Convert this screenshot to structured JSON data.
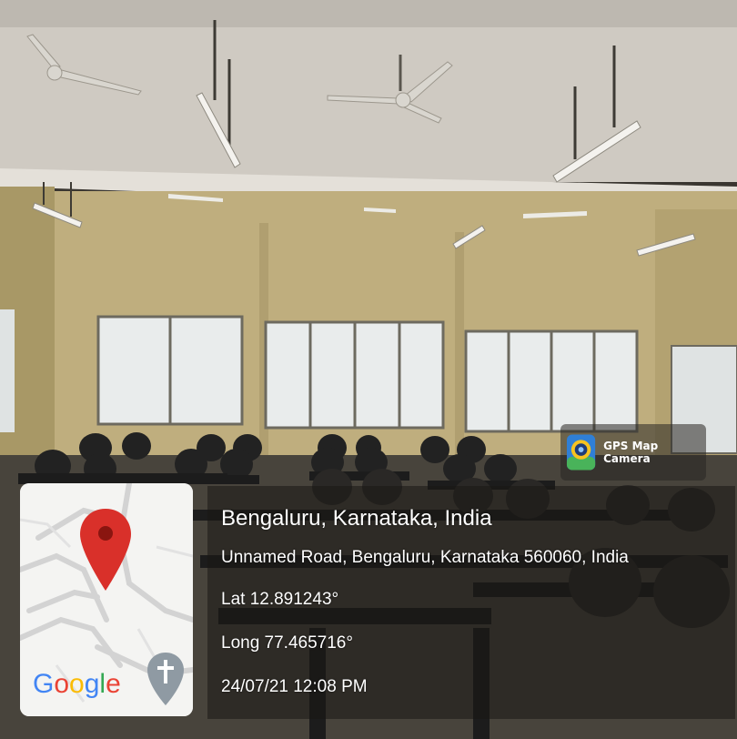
{
  "badge": {
    "app_name": "GPS Map Camera",
    "icon": "gps-map-camera-icon"
  },
  "map": {
    "brand": "Google",
    "pin_icon": "location-pin-icon",
    "place_icon": "church-place-icon"
  },
  "location": {
    "city_line": "Bengaluru, Karnataka, India",
    "address": "Unnamed Road, Bengaluru, Karnataka 560060, India",
    "lat": "Lat 12.891243°",
    "long": "Long 77.465716°",
    "datetime": "24/07/21 12:08 PM"
  },
  "colors": {
    "google_blue": "#4285F4",
    "google_red": "#EA4335",
    "google_yellow": "#FBBC05",
    "google_green": "#34A853",
    "pin_red": "#D9302A"
  }
}
